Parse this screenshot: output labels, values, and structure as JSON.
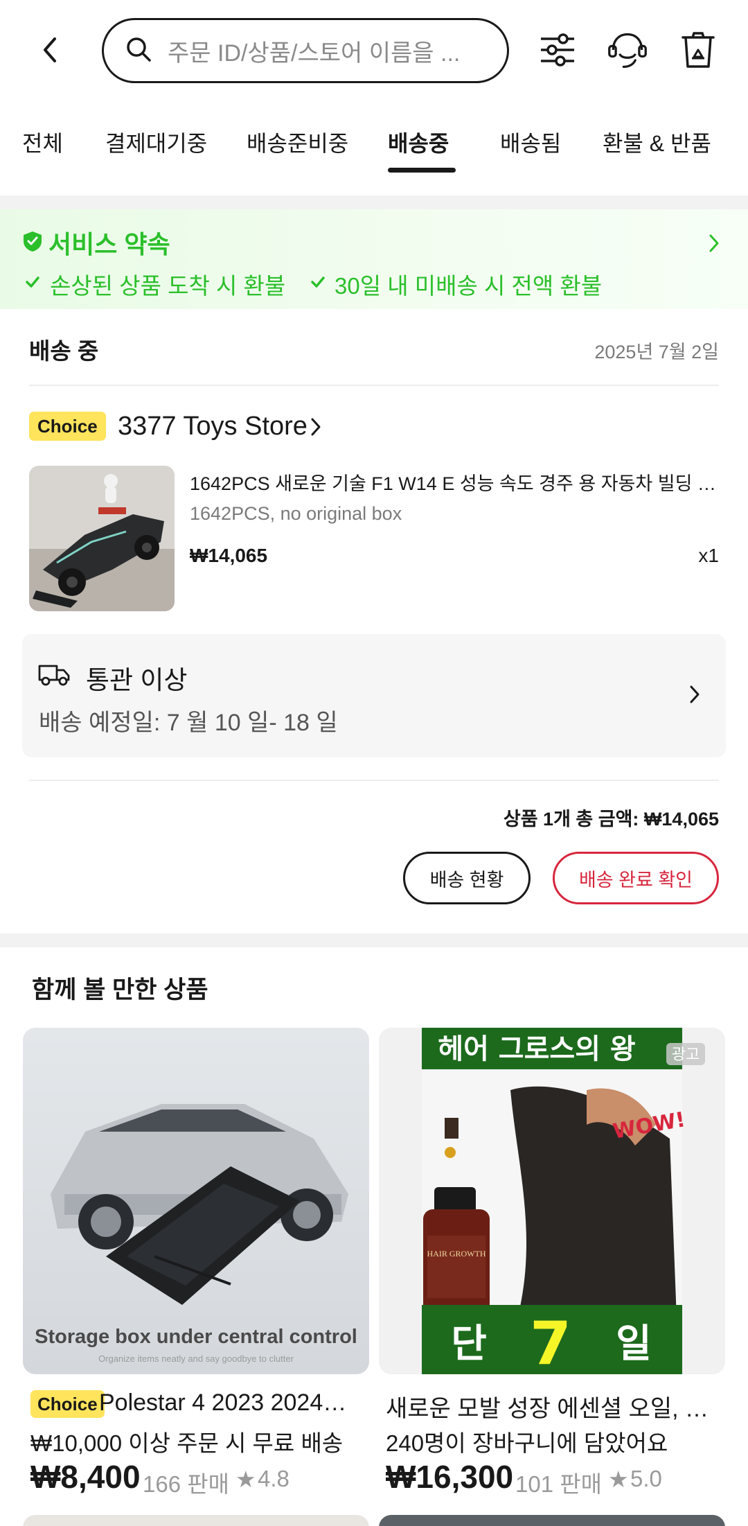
{
  "header": {
    "search_placeholder": "주문 ID/상품/스토어 이름을 ...",
    "icons": [
      "back-arrow-icon",
      "search-icon",
      "filter-sliders-icon",
      "customer-service-icon",
      "recycle-bin-icon"
    ]
  },
  "tabs": [
    {
      "label": "전체",
      "active": false
    },
    {
      "label": "결제대기중",
      "active": false
    },
    {
      "label": "배송준비중",
      "active": false
    },
    {
      "label": "배송중",
      "active": true
    },
    {
      "label": "배송됨",
      "active": false
    },
    {
      "label": "환불 & 반품",
      "active": false
    }
  ],
  "service": {
    "title": "서비스 약속",
    "promises": [
      "손상된 상품 도착 시 환불",
      "30일 내 미배송 시 전액 환불"
    ],
    "accent": "#2bbf2b"
  },
  "order": {
    "status": "배송 중",
    "date": "2025년 7월 2일",
    "store": {
      "badge": "Choice",
      "name": "3377 Toys Store"
    },
    "item": {
      "title": "1642PCS 새로운 기술 F1 W14 E 성능 속도 경주 용 자동차 빌딩 블록 ...",
      "variant": "1642PCS, no original box",
      "price": "₩14,065",
      "qty": "x1"
    },
    "customs": {
      "title": "통관 이상",
      "eta": "배송 예정일: 7 월 10 일- 18 일"
    },
    "total": "상품 1개 총 금액: ₩14,065",
    "buttons": {
      "track": "배송 현황",
      "confirm": "배송 완료 확인"
    },
    "accent_red": "#d7263d"
  },
  "recommendations": {
    "title": "함께 볼 만한 상품",
    "items": [
      {
        "badge": "Choice",
        "name": "Polestar 4 2023 2024 ...",
        "line2": "₩10,000 이상 주문 시 무료 배송",
        "price": "₩8,400",
        "sold": "166 판매",
        "rating": "4.8",
        "image_caption": "Storage box under central control",
        "image_subcaption": "Organize items neatly and say goodbye to clutter"
      },
      {
        "badge": "",
        "name": "새로운 모발 성장 에센셜 오일, 엄...",
        "line2": "240명이 장바구니에 담았어요",
        "price": "₩16,300",
        "sold": "101 판매",
        "rating": "5.0",
        "ad_label": "광고",
        "image_top_text": "헤어 그로스의 왕",
        "image_bottom_left": "단",
        "image_bottom_num": "7",
        "image_bottom_right": "일",
        "image_wow": "WOW!",
        "image_bottle_label": "HAIR GROWTH"
      }
    ]
  }
}
